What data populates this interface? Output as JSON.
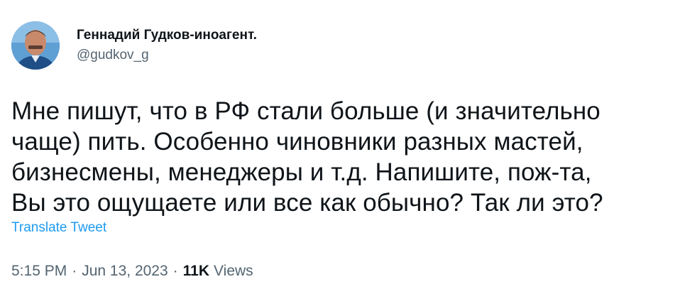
{
  "author": {
    "display_name": "Геннадий Гудков-иноагент.",
    "handle": "@gudkov_g"
  },
  "tweet": {
    "text": "Мне пишут, что в РФ стали больше (и значительно\nчаще) пить. Особенно чиновники разных мастей,\nбизнесмены, менеджеры и т.д. Напишите, пож-та,\nВы это ощущаете или все как обычно? Так ли это?",
    "translate_label": "Translate Tweet"
  },
  "meta": {
    "time": "5:15 PM",
    "separator": "·",
    "date": "Jun 13, 2023",
    "views_count": "11K",
    "views_label": "Views"
  },
  "colors": {
    "text": "#0f1419",
    "secondary": "#536471",
    "link": "#1d9bf0"
  }
}
